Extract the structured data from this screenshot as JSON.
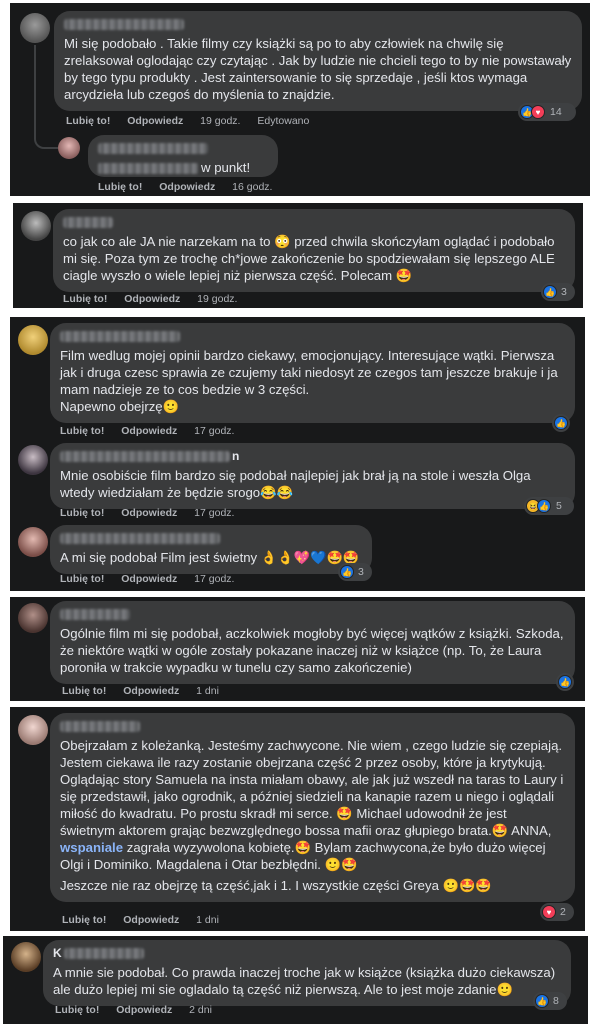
{
  "labels": {
    "like": "Lubię to!",
    "reply": "Odpowiedz",
    "edited": "Edytowano"
  },
  "colors": {
    "panel": "#18191a",
    "bubble": "#3a3b3c",
    "text": "#e4e6eb",
    "meta": "#b0b3b8",
    "like": "#1b74e4",
    "heart": "#f33e58"
  },
  "c1": {
    "text": "Mi się podobało . Takie filmy czy książki są po to aby człowiek na chwilę się zrelaksował oglodając czy czytając . Jak by ludzie nie chcieli tego to by nie powstawały by tego typu produkty . Jest zaintersowanie to się sprzedaje , jeśli ktos wymaga arcydzieła lub czegoś do myślenia to znajdzie.",
    "time": "19 godz.",
    "count": "14",
    "reply_text": "w punkt!",
    "reply_time": "16 godz."
  },
  "c2": {
    "text": "co jak co ale JA nie narzekam na to 😳 przed chwila skończyłam oglądać i podobało mi się. Poza tym ze trochę ch*jowe zakończenie bo spodziewałam się lepszego ALE ciagle wyszło o wiele lepiej niż pierwsza część. Polecam 🤩",
    "time": "19 godz.",
    "count": "3"
  },
  "c3": {
    "text": "Film wedlug mojej opinii bardzo ciekawy, emocjonujący. Interesujące wątki. Pierwsza jak i druga czesc sprawia ze czujemy taki niedosyt ze czegos tam jeszcze brakuje i ja mam nadzieje ze to cos bedzie w 3 części.",
    "text2": "Napewno obejrzę🙂",
    "time": "17 godz."
  },
  "c4": {
    "name_suffix": "n",
    "text": "Mnie osobiście film bardzo się podobał najlepiej jak brał ją na stole i weszła Olga wtedy wiedziałam że będzie srogo😂😂",
    "time": "17 godz.",
    "count": "5"
  },
  "c5": {
    "text": "A mi się podobał Film jest świetny 👌👌💖💙🤩🤩",
    "time": "17 godz.",
    "count": "3"
  },
  "c6": {
    "text": "Ogólnie film mi się podobał, aczkolwiek mogłoby być więcej wątków z książki. Szkoda, że niektóre wątki w ogóle zostały pokazane inaczej niż w książce (np. To, że Laura poroniła w trakcie wypadku w tunelu czy samo zakończenie)",
    "time": "1 dni"
  },
  "c7": {
    "text_a": "Obejrzałam z koleżanką. Jesteśmy zachwycone. Nie wiem , czego ludzie się czepiają. Jestem ciekawa ile razy zostanie obejrzana część 2 przez osoby, które ja krytykują. Oglądając story Samuela na insta miałam obawy, ale jak już wszedł na taras to Laury i się przedstawił, jako ogrodnik, a później siedzieli na kanapie razem u niego i oglądali miłość do kwadratu. Po prostu skradł mi serce. 🤩 Michael udowodnił że jest świetnym aktorem grając bezwzględnego bossa mafii oraz głupiego brata.🤩",
    "text_b": "ANNA,",
    "link": "wspaniale",
    "text_c": "zagrała wyzywolona kobietę.🤩 Bylam zachwycona,że było dużo więcej Olgi i Dominiko. Magdalena i Otar bezbłędni. 🙂🤩",
    "text2": "Jeszcze nie raz obejrzę tą część,jak i 1. I wszystkie części Greya 🙂🤩🤩",
    "time": "1 dni",
    "count": "2"
  },
  "c8": {
    "name_prefix": "K",
    "text": "A mnie sie podobał. Co prawda inaczej troche jak w książce (książka dużo ciekawsza) ale dużo lepiej mi sie ogladalo tą część niż pierwszą. Ale to jest moje zdanie🙂",
    "time": "2 dni",
    "count": "8"
  }
}
